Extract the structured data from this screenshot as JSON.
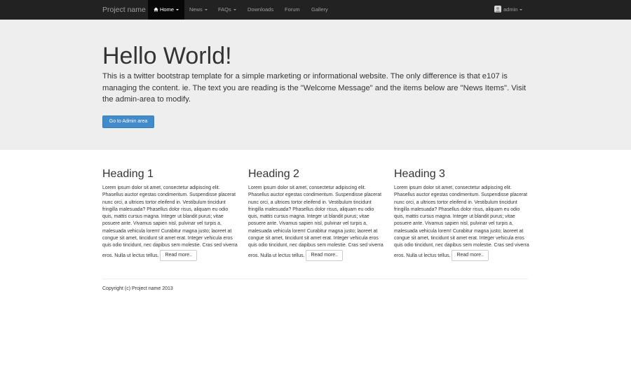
{
  "navbar": {
    "brand": "Project name",
    "items": [
      {
        "label": "Home",
        "active": true,
        "dropdown": true,
        "icon": "home-icon"
      },
      {
        "label": "News",
        "dropdown": true
      },
      {
        "label": "FAQs",
        "dropdown": true
      },
      {
        "label": "Downloads",
        "dropdown": false
      },
      {
        "label": "Forum",
        "dropdown": false
      },
      {
        "label": "Gallery",
        "dropdown": false
      }
    ],
    "user": {
      "label": "admin",
      "dropdown": true
    }
  },
  "jumbotron": {
    "title": "Hello World!",
    "text": "This is a twitter bootstrap template for a simple marketing or informational website. The only difference is that e107 is managing the content. ie. The text you are reading is the \"Welcome Message\" and the items below are \"News Items\". Visit the admin-area to modify.",
    "button": "Go to Admin area"
  },
  "columns": [
    {
      "heading": "Heading 1",
      "body": "Lorem ipsum dolor sit amet, consectetur adipiscing elit. Phasellus auctor egestas condimentum. Suspendisse placerat nunc orci, a ultrices tortor eleifend in. Vestibulum tincidunt fringilla malesuada? Phasellus dolor risus, aliquam eu odio quis, mattis cursus magna. Integer ut blandit purus; vitae posuere ante. Vivamus sapien nisl, pulvinar vel turpis a, malesuada vehicula lorem! Curabitur magna justo; laoreet at congue sit amet, tincidunt sit amet erat. Integer vehicula eros quis odio tincidunt, nec dapibus sem molestie. Cras sed viverra eros. Nulla ut lectus tellus.",
      "button": "Read more.."
    },
    {
      "heading": "Heading 2",
      "body": "Lorem ipsum dolor sit amet, consectetur adipiscing elit. Phasellus auctor egestas condimentum. Suspendisse placerat nunc orci, a ultrices tortor eleifend in. Vestibulum tincidunt fringilla malesuada? Phasellus dolor risus, aliquam eu odio quis, mattis cursus magna. Integer ut blandit purus; vitae posuere ante. Vivamus sapien nisl, pulvinar vel turpis a, malesuada vehicula lorem! Curabitur magna justo; laoreet at congue sit amet, tincidunt sit amet erat. Integer vehicula eros quis odio tincidunt, nec dapibus sem molestie. Cras sed viverra eros. Nulla ut lectus tellus.",
      "button": "Read more.."
    },
    {
      "heading": "Heading 3",
      "body": "Lorem ipsum dolor sit amet, consectetur adipiscing elit. Phasellus auctor egestas condimentum. Suspendisse placerat nunc orci, a ultrices tortor eleifend in. Vestibulum tincidunt fringilla malesuada? Phasellus dolor risus, aliquam eu odio quis, mattis cursus magna. Integer ut blandit purus; vitae posuere ante. Vivamus sapien nisl, pulvinar vel turpis a, malesuada vehicula lorem! Curabitur magna justo; laoreet at congue sit amet, tincidunt sit amet erat. Integer vehicula eros quis odio tincidunt, nec dapibus sem molestie. Cras sed viverra eros. Nulla ut lectus tellus.",
      "button": "Read more.."
    }
  ],
  "footer": {
    "text": "Copyright (c) Project name 2013"
  },
  "colors": {
    "navbar_bg": "#222222",
    "navbar_active_bg": "#080808",
    "jumbotron_bg": "#eeeeee",
    "primary": "#428bca"
  }
}
